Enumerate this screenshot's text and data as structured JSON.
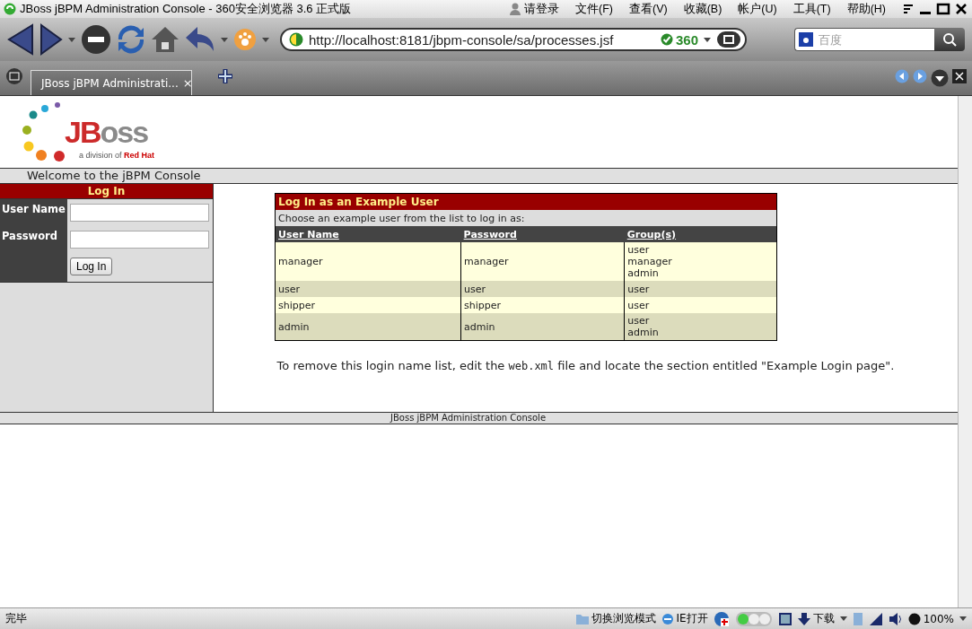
{
  "window": {
    "title": "JBoss jBPM Administration Console - 360安全浏览器 3.6 正式版"
  },
  "menu": [
    "请登录",
    "文件(F)",
    "查看(V)",
    "收藏(B)",
    "帐户(U)",
    "工具(T)",
    "帮助(H)"
  ],
  "address_bar": {
    "url": "http://localhost:8181/jbpm-console/sa/processes.jsf",
    "badge": "360"
  },
  "search": {
    "placeholder": "百度"
  },
  "tabs": [
    {
      "label": "JBoss jBPM Administrati...",
      "selected": true,
      "close": "×"
    }
  ],
  "logo": {
    "mark_red": "JB",
    "mark_gray": "oss",
    "tagline": "a division of ",
    "tagline_brand": "Red Hat"
  },
  "welcome": "Welcome to the jBPM Console",
  "login": {
    "title": "Log In",
    "fields": [
      {
        "label": "User Name"
      },
      {
        "label": "Password"
      }
    ],
    "button": "Log In"
  },
  "examples": {
    "title": "Log In as an Example User",
    "hint": "Choose an example user from the list to log in as:",
    "columns": [
      "User Name",
      "Password",
      "Group(s)"
    ],
    "rows": [
      {
        "user": "manager",
        "password": "manager",
        "groups": [
          "user",
          "manager",
          "admin"
        ]
      },
      {
        "user": "user",
        "password": "user",
        "groups": [
          "user"
        ]
      },
      {
        "user": "shipper",
        "password": "shipper",
        "groups": [
          "user"
        ]
      },
      {
        "user": "admin",
        "password": "admin",
        "groups": [
          "user",
          "admin"
        ]
      }
    ]
  },
  "note": {
    "before": "To remove this login name list, edit the ",
    "code": "web.xml",
    "after": " file and locate the section entitled \"Example Login page\"."
  },
  "footer": "JBoss jBPM Administration Console",
  "status_bar": {
    "text": "完毕",
    "switch_mode": "切换浏览模式",
    "open_ie": "IE打开",
    "download": "下载",
    "zoom": "100%"
  }
}
